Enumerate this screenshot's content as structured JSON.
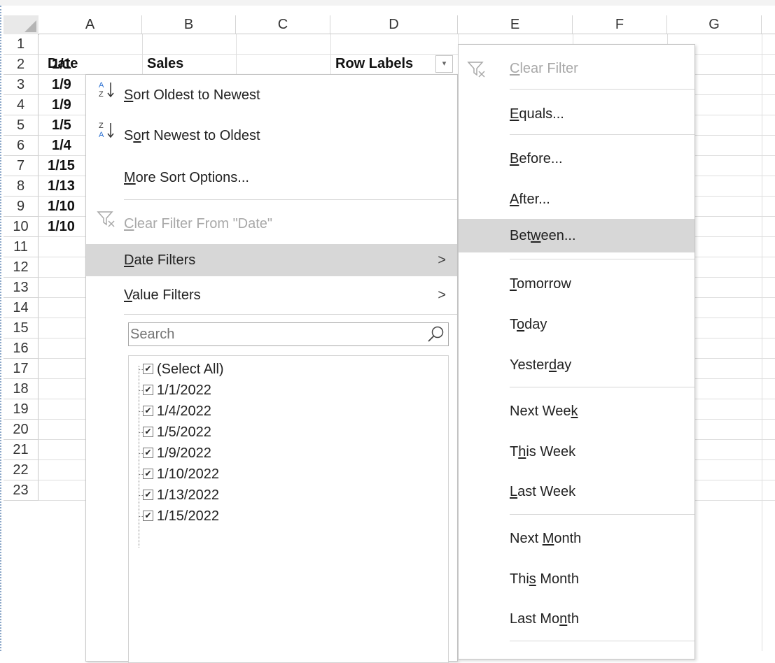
{
  "columns": [
    "A",
    "B",
    "C",
    "D",
    "E",
    "F",
    "G"
  ],
  "rows": [
    "1",
    "2",
    "3",
    "4",
    "5",
    "6",
    "7",
    "8",
    "9",
    "10",
    "11",
    "12",
    "13",
    "14",
    "15",
    "16",
    "17",
    "18",
    "19",
    "20",
    "21",
    "22",
    "23"
  ],
  "cells": {
    "a1": "Date",
    "b1": "Sales",
    "d1": "Row Labels",
    "a_col": [
      "1/1",
      "1/9",
      "1/9",
      "1/5",
      "1/4",
      "1/15",
      "1/13",
      "1/10",
      "1/10"
    ]
  },
  "dropdown_arrow": "▾",
  "menu": {
    "sort_oldest": {
      "pre": "",
      "ul": "S",
      "post": "ort Oldest to Newest"
    },
    "sort_newest": {
      "pre": "S",
      "ul": "o",
      "post": "rt Newest to Oldest"
    },
    "more_sort": {
      "pre": "",
      "ul": "M",
      "post": "ore Sort Options..."
    },
    "clear_filter": {
      "pre": "",
      "ul": "C",
      "post": "lear Filter From \"Date\""
    },
    "date_filters": {
      "pre": "",
      "ul": "D",
      "post": "ate Filters"
    },
    "value_filters": {
      "pre": "",
      "ul": "V",
      "post": "alue Filters"
    },
    "submenu_arrow": ">",
    "search_placeholder": "Search",
    "items": [
      "(Select All)",
      "1/1/2022",
      "1/4/2022",
      "1/5/2022",
      "1/9/2022",
      "1/10/2022",
      "1/13/2022",
      "1/15/2022"
    ],
    "check_glyph": "✔"
  },
  "submenu": {
    "clear_filter": {
      "pre": "",
      "ul": "C",
      "post": "lear Filter"
    },
    "equals": {
      "pre": "",
      "ul": "E",
      "post": "quals..."
    },
    "before": {
      "pre": "",
      "ul": "B",
      "post": "efore..."
    },
    "after": {
      "pre": "",
      "ul": "A",
      "post": "fter..."
    },
    "between": {
      "pre": "Bet",
      "ul": "w",
      "post": "een..."
    },
    "tomorrow": {
      "pre": "",
      "ul": "T",
      "post": "omorrow"
    },
    "today": {
      "pre": "T",
      "ul": "o",
      "post": "day"
    },
    "yesterday": {
      "pre": "Yester",
      "ul": "d",
      "post": "ay"
    },
    "next_week": {
      "pre": "Next Wee",
      "ul": "k",
      "post": ""
    },
    "this_week": {
      "pre": "T",
      "ul": "h",
      "post": "is Week"
    },
    "last_week": {
      "pre": "",
      "ul": "L",
      "post": "ast Week"
    },
    "next_month": {
      "pre": "Next ",
      "ul": "M",
      "post": "onth"
    },
    "this_month": {
      "pre": "Thi",
      "ul": "s",
      "post": " Month"
    },
    "last_month": {
      "pre": "Last Mo",
      "ul": "n",
      "post": "th"
    }
  },
  "colors": {
    "highlight": "#d7d7d7",
    "disabled": "#a8a8a8",
    "sort_icon_blue": "#2a6fd1"
  }
}
